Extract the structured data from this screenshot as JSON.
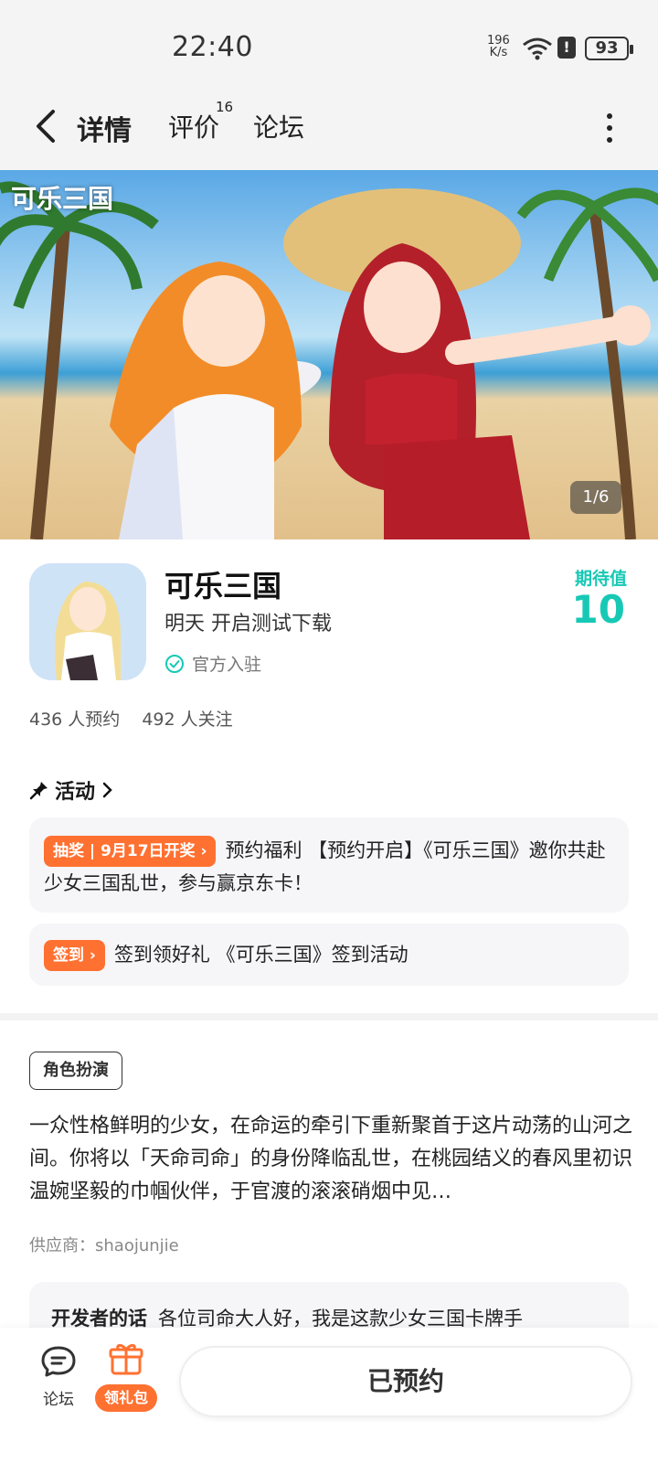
{
  "status_bar": {
    "time": "22:40",
    "net_speed_value": "196",
    "net_speed_unit": "K/s",
    "battery": "93"
  },
  "nav": {
    "tabs": [
      {
        "label": "详情",
        "active": true
      },
      {
        "label": "评价",
        "badge": "16"
      },
      {
        "label": "论坛"
      }
    ]
  },
  "hero": {
    "logo_text": "可乐三国",
    "counter": "1/6"
  },
  "game": {
    "title": "可乐三国",
    "status": "明天 开启测试下载",
    "official_label": "官方入驻",
    "expect_label": "期待值",
    "expect_value": "10",
    "reservations": "436 人预约",
    "followers": "492 人关注"
  },
  "activities": {
    "header": "活动",
    "items": [
      {
        "tag": "抽奖 | 9月17日开奖 ›",
        "text": "预约福利 【预约开启】《可乐三国》邀你共赴少女三国乱世，参与赢京东卡！"
      },
      {
        "tag": "签到 ›",
        "text": "签到领好礼 《可乐三国》签到活动"
      }
    ]
  },
  "description": {
    "genre": "角色扮演",
    "text": "一众性格鲜明的少女，在命运的牵引下重新聚首于这片动荡的山河之间。你将以「天命司命」的身份降临乱世，在桃园结义的春风里初识温婉坚毅的巾帼伙伴，于官渡的滚滚硝烟中见…",
    "supplier": "供应商：shaojunjie"
  },
  "developer": {
    "label": "开发者的话",
    "text": "各位司命大人好，我是这款少女三国卡牌手"
  },
  "bottom_bar": {
    "forum_label": "论坛",
    "gift_label": "领礼包",
    "reserve_label": "已预约"
  },
  "colors": {
    "accent": "#17c9b5",
    "orange": "#ff7131"
  }
}
